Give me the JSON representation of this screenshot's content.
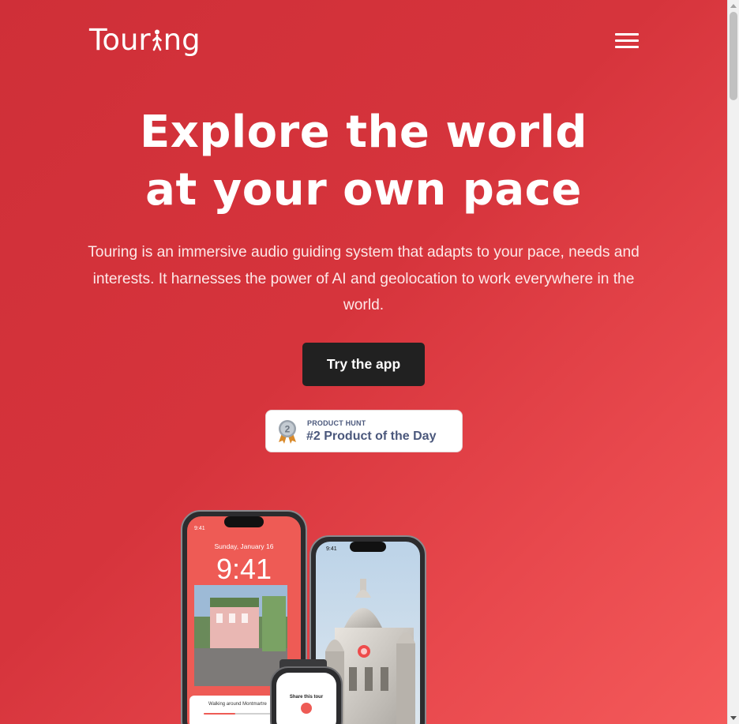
{
  "header": {
    "logo_text_left": "Tour",
    "logo_text_right": "ng",
    "menu_icon": "hamburger-menu-icon"
  },
  "hero": {
    "title_line1": "Explore the world",
    "title_line2": "at your own pace",
    "subtitle": "Touring is an immersive audio guiding system that adapts to your pace, needs and interests. It harnesses the power of AI and geolocation to work everywhere in the world.",
    "cta_label": "Try the app"
  },
  "product_hunt": {
    "eyebrow": "PRODUCT HUNT",
    "title": "#2 Product of the Day",
    "medal_number": "2",
    "medal_icon": "silver-medal-icon"
  },
  "devices": {
    "phone1_date": "Sunday, January 16",
    "phone1_time": "9:41",
    "phone1_status_time": "9:41",
    "phone1_caption": "Walking around Montmartre",
    "phone2_status_time": "9:41",
    "watch_caption": "Share this tour"
  },
  "colors": {
    "background_start": "#cf2f38",
    "background_end": "#f45a5a",
    "cta_background": "#212121",
    "badge_text": "#4b587c"
  }
}
